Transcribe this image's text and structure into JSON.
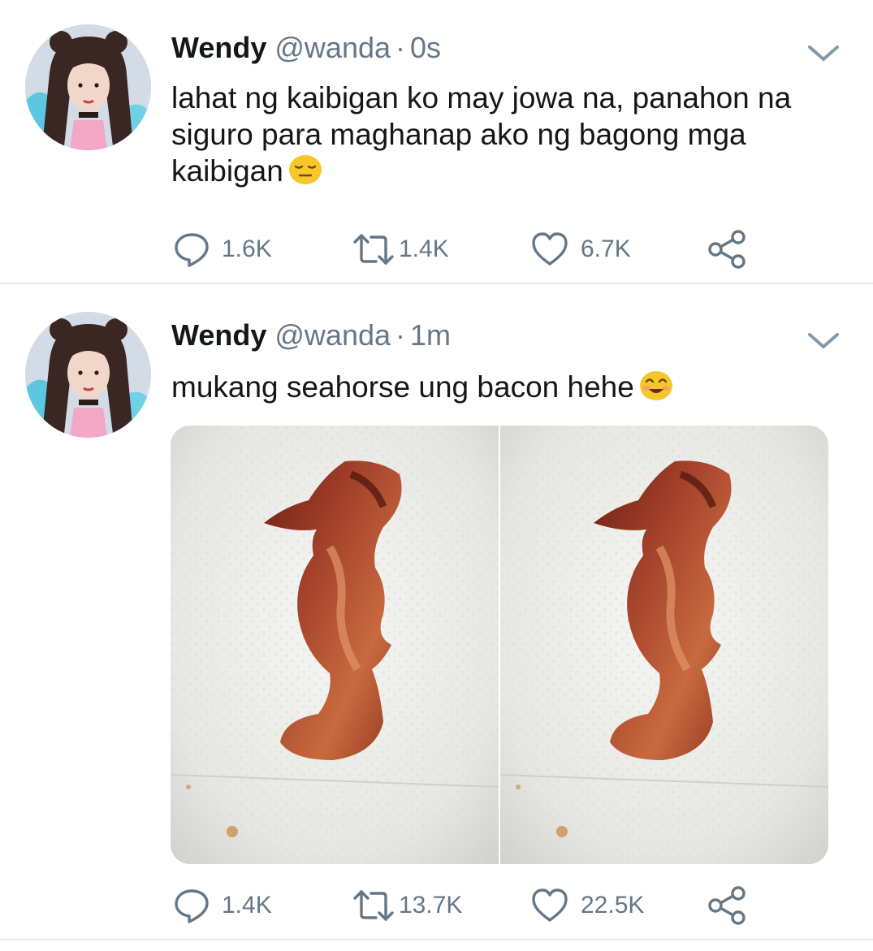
{
  "colors": {
    "text_primary": "#14171a",
    "text_secondary": "#657786",
    "divider": "#e6ecf0",
    "emoji_yellow": "#f7c62b"
  },
  "tweets": [
    {
      "name": "Wendy",
      "handle": "@wanda",
      "separator": "·",
      "time": "0s",
      "text": "lahat ng kaibigan ko may jowa na, panahon na siguro para maghanap ako ng bagong mga kaibigan",
      "emoji": "expressionless-face-emoji",
      "actions": {
        "replies": "1.6K",
        "retweets": "1.4K",
        "likes": "6.7K"
      }
    },
    {
      "name": "Wendy",
      "handle": "@wanda",
      "separator": "·",
      "time": "1m",
      "text": "mukang seahorse ung bacon hehe",
      "emoji": "smiling-face-with-smiling-eyes-emoji",
      "media": "two-photos-of-seahorse-shaped-bacon-on-paper-towel",
      "actions": {
        "replies": "1.4K",
        "retweets": "13.7K",
        "likes": "22.5K"
      }
    }
  ]
}
